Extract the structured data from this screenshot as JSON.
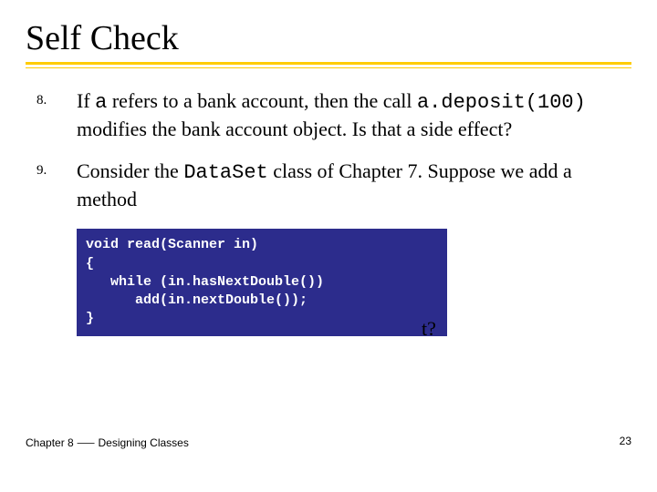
{
  "title": "Self Check",
  "items": [
    {
      "num": "8.",
      "pre": "If ",
      "code1": "a",
      "mid1": " refers to a bank account, then the call ",
      "code2": "a.deposit(100)",
      "post": " modifies the bank account object. Is that a side effect?"
    },
    {
      "num": "9.",
      "pre": "Consider the ",
      "code1": "DataSet",
      "post": " class of Chapter 7. Suppose we add a method"
    }
  ],
  "code": "void read(Scanner in)\n{\n   while (in.hasNextDouble())\n      add(in.nextDouble());\n}",
  "trail": "t?",
  "footer_left": "Chapter 8 ⸺ Designing Classes",
  "footer_right": "23"
}
